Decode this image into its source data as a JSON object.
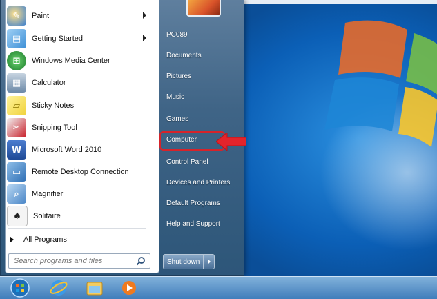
{
  "left_programs": [
    {
      "label": "Paint",
      "icon": "paint-icon",
      "color": "#3a7fd0",
      "has_submenu": true
    },
    {
      "label": "Getting Started",
      "icon": "getting-started-icon",
      "color": "#3d8fd6",
      "has_submenu": true
    },
    {
      "label": "Windows Media Center",
      "icon": "media-center-icon",
      "color": "#2a9b3a",
      "has_submenu": false
    },
    {
      "label": "Calculator",
      "icon": "calculator-icon",
      "color": "#6d8aa8",
      "has_submenu": false
    },
    {
      "label": "Sticky Notes",
      "icon": "sticky-notes-icon",
      "color": "#f0d23c",
      "has_submenu": false
    },
    {
      "label": "Snipping Tool",
      "icon": "snipping-tool-icon",
      "color": "#c8202a",
      "has_submenu": false
    },
    {
      "label": "Microsoft Word 2010",
      "icon": "word-icon",
      "color": "#2b5aa8",
      "has_submenu": false
    },
    {
      "label": "Remote Desktop Connection",
      "icon": "remote-desktop-icon",
      "color": "#2f6fb5",
      "has_submenu": false
    },
    {
      "label": "Magnifier",
      "icon": "magnifier-icon",
      "color": "#4a86c7",
      "has_submenu": false
    },
    {
      "label": "Solitaire",
      "icon": "solitaire-icon",
      "color": "#e6e6e6",
      "has_submenu": false
    }
  ],
  "all_programs_label": "All Programs",
  "search": {
    "placeholder": "Search programs and files"
  },
  "right_items": [
    {
      "label": "PC089"
    },
    {
      "label": "Documents"
    },
    {
      "label": "Pictures"
    },
    {
      "label": "Music"
    },
    {
      "label": "Games"
    },
    {
      "label": "Computer"
    },
    {
      "label": "Control Panel"
    },
    {
      "label": "Devices and Printers"
    },
    {
      "label": "Default Programs"
    },
    {
      "label": "Help and Support"
    }
  ],
  "shutdown_label": "Shut down",
  "colors": {
    "highlight": "#d6232a",
    "pane": "#3f6486",
    "accent": "#0c5aa6"
  },
  "taskbar": [
    {
      "icon": "start-orb-icon"
    },
    {
      "icon": "internet-explorer-icon"
    },
    {
      "icon": "file-explorer-icon"
    },
    {
      "icon": "media-player-icon"
    }
  ]
}
